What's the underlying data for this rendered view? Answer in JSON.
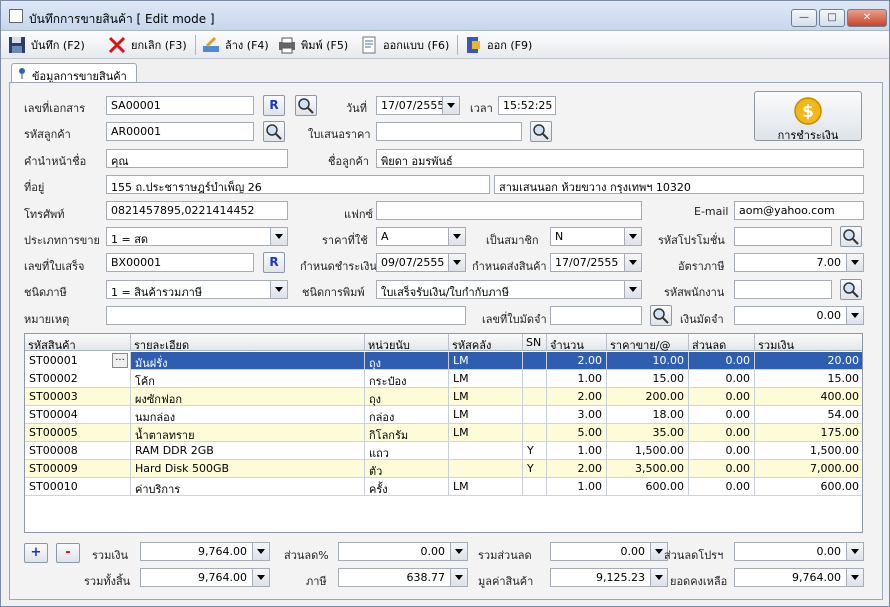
{
  "window": {
    "title": "บันทึกการขายสินค้า [ Edit mode ]",
    "controls": [
      "minimize",
      "maximize",
      "close"
    ]
  },
  "toolbar": {
    "save": "บันทึก (F2)",
    "cancel": "ยกเลิก (F3)",
    "clear": "ล้าง (F4)",
    "print": "พิมพ์ (F5)",
    "design": "ออกแบบ (F6)",
    "exit": "ออก (F9)"
  },
  "tab": {
    "label": "ข้อมูลการขายสินค้า"
  },
  "form": {
    "doc_no_label": "เลขที่เอกสาร",
    "doc_no": "SA00001",
    "r_label": "R",
    "date_label": "วันที่",
    "date": "17/07/2555",
    "time_label": "เวลา",
    "time": "15:52:25",
    "pay_label": "การชำระเงิน",
    "customer_code_label": "รหัสลูกค้า",
    "customer_code": "AR00001",
    "quote_label": "ใบเสนอราคา",
    "quote": "",
    "prefix_label": "คำนำหน้าชื่อ",
    "prefix": "คุณ",
    "customer_name_label": "ชื่อลูกค้า",
    "customer_name": "พิยดา อมรพันธ์",
    "address_label": "ที่อยู่",
    "address1": "155 ถ.ประชาราษฎร์บำเพ็ญ 26",
    "address2": "สามเสนนอก ห้วยขวาง กรุงเทพฯ 10320",
    "phone_label": "โทรศัพท์",
    "phone": "0821457895,0221414452",
    "fax_label": "แฟกซ์",
    "fax": "",
    "email_label": "E-mail",
    "email": "aom@yahoo.com",
    "sale_type_label": "ประเภทการขาย",
    "sale_type": "1 = สด",
    "price_label": "ราคาที่ใช้",
    "price": "A",
    "member_label": "เป็นสมาชิก",
    "member": "N",
    "promo_label": "รหัสโปรโมชั่น",
    "promo": "",
    "receipt_label": "เลขที่ใบเสร็จ",
    "receipt": "BX00001",
    "pay_due_label": "กำหนดชำระเงิน",
    "pay_due": "09/07/2555",
    "ship_due_label": "กำหนดส่งสินค้า",
    "ship_due": "17/07/2555",
    "tax_rate_label": "อัตราภาษี",
    "tax_rate": "7.00",
    "tax_type_label": "ชนิดภาษี",
    "tax_type": "1 = สินค้ารวมภาษี",
    "print_type_label": "ชนิดการพิมพ์",
    "print_type": "ใบเสร็จรับเงิน/ใบกำกับภาษี",
    "employee_label": "รหัสพนักงาน",
    "employee": "",
    "note_label": "หมายเหตุ",
    "note": "",
    "deposit_no_label": "เลขที่ใบมัดจำ",
    "deposit_no": "",
    "deposit_label": "เงินมัดจำ",
    "deposit": "0.00"
  },
  "grid": {
    "columns": [
      "รหัสสินค้า",
      "รายละเอียด",
      "หน่วยนับ",
      "รหัสคลัง",
      "SN",
      "จำนวน",
      "ราคาขาย/@",
      "ส่วนลด",
      "รวมเงิน"
    ],
    "rows": [
      {
        "code": "ST00001",
        "desc": "มันฝรั่ง",
        "unit": "ถุง",
        "wh": "LM",
        "sn": "",
        "qty": "2.00",
        "price": "10.00",
        "disc": "0.00",
        "total": "20.00"
      },
      {
        "code": "ST00002",
        "desc": "โค้ก",
        "unit": "กระป๋อง",
        "wh": "LM",
        "sn": "",
        "qty": "1.00",
        "price": "15.00",
        "disc": "0.00",
        "total": "15.00"
      },
      {
        "code": "ST00003",
        "desc": "ผงซักฟอก",
        "unit": "ถุง",
        "wh": "LM",
        "sn": "",
        "qty": "2.00",
        "price": "200.00",
        "disc": "0.00",
        "total": "400.00"
      },
      {
        "code": "ST00004",
        "desc": "นมกล่อง",
        "unit": "กล่อง",
        "wh": "LM",
        "sn": "",
        "qty": "3.00",
        "price": "18.00",
        "disc": "0.00",
        "total": "54.00"
      },
      {
        "code": "ST00005",
        "desc": "น้ำตาลทราย",
        "unit": "กิโลกรัม",
        "wh": "LM",
        "sn": "",
        "qty": "5.00",
        "price": "35.00",
        "disc": "0.00",
        "total": "175.00"
      },
      {
        "code": "ST00008",
        "desc": "RAM DDR 2GB",
        "unit": "แถว",
        "wh": "",
        "sn": "Y",
        "qty": "1.00",
        "price": "1,500.00",
        "disc": "0.00",
        "total": "1,500.00"
      },
      {
        "code": "ST00009",
        "desc": "Hard Disk 500GB",
        "unit": "ตัว",
        "wh": "",
        "sn": "Y",
        "qty": "2.00",
        "price": "3,500.00",
        "disc": "0.00",
        "total": "7,000.00"
      },
      {
        "code": "ST00010",
        "desc": "ค่าบริการ",
        "unit": "ครั้ง",
        "wh": "LM",
        "sn": "",
        "qty": "1.00",
        "price": "600.00",
        "disc": "0.00",
        "total": "600.00"
      }
    ]
  },
  "summary": {
    "add_label": "+",
    "remove_label": "-",
    "subtotal_label": "รวมเงิน",
    "subtotal": "9,764.00",
    "disc_pct_label": "ส่วนลด%",
    "disc_pct": "0.00",
    "disc_total_label": "รวมส่วนลด",
    "disc_total": "0.00",
    "promo_disc_label": "ส่วนลดโปรฯ",
    "promo_disc": "0.00",
    "grand_label": "รวมทั้งสิ้น",
    "grand": "9,764.00",
    "tax_label": "ภาษี",
    "tax": "638.77",
    "value_label": "มูลค่าสินค้า",
    "value": "9,125.23",
    "balance_label": "ยอดคงเหลือ",
    "balance": "9,764.00"
  }
}
